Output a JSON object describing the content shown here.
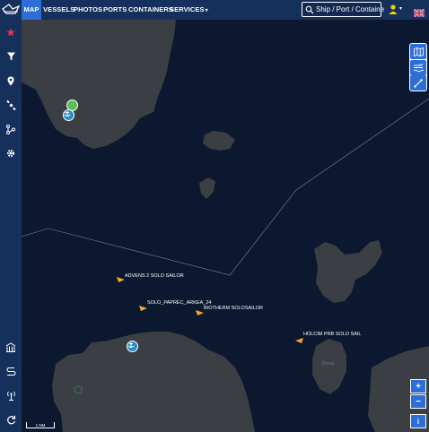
{
  "nav": {
    "items": [
      {
        "label": "MAP"
      },
      {
        "label": "VESSELS"
      },
      {
        "label": "PHOTOS"
      },
      {
        "label": "PORTS"
      },
      {
        "label": "CONTAINERS"
      },
      {
        "label": "SERVICES"
      }
    ],
    "active": "MAP"
  },
  "search": {
    "placeholder": "Ship / Port / Container"
  },
  "sidebar": {
    "icons": [
      "star-icon",
      "filter-icon",
      "location-pin-icon",
      "satellite-icon",
      "route-icon",
      "gear-icon",
      "port-building-icon",
      "route-alt-icon",
      "antenna-icon",
      "refresh-icon"
    ]
  },
  "map": {
    "vessel_labels": [
      {
        "name": "ADVENS 2 SOLO SAILOR"
      },
      {
        "name": "SOLO_PAPREC_ARKEA_24"
      },
      {
        "name": "BIOTHERM SOLOSAILOR"
      },
      {
        "name": "HOLCIM PRB SOLO SAIL"
      }
    ],
    "place_labels": [
      "Sheep"
    ],
    "scale_label": "1 NM",
    "zoom_in": "+",
    "zoom_out": "−",
    "info": "i"
  },
  "colors": {
    "topbar": "#16305c",
    "active_tab": "#2d6fd6",
    "sea": "#0b1830",
    "land": "#3b3e42",
    "vessel": "#f5a623",
    "favorite": "#e8334a"
  }
}
